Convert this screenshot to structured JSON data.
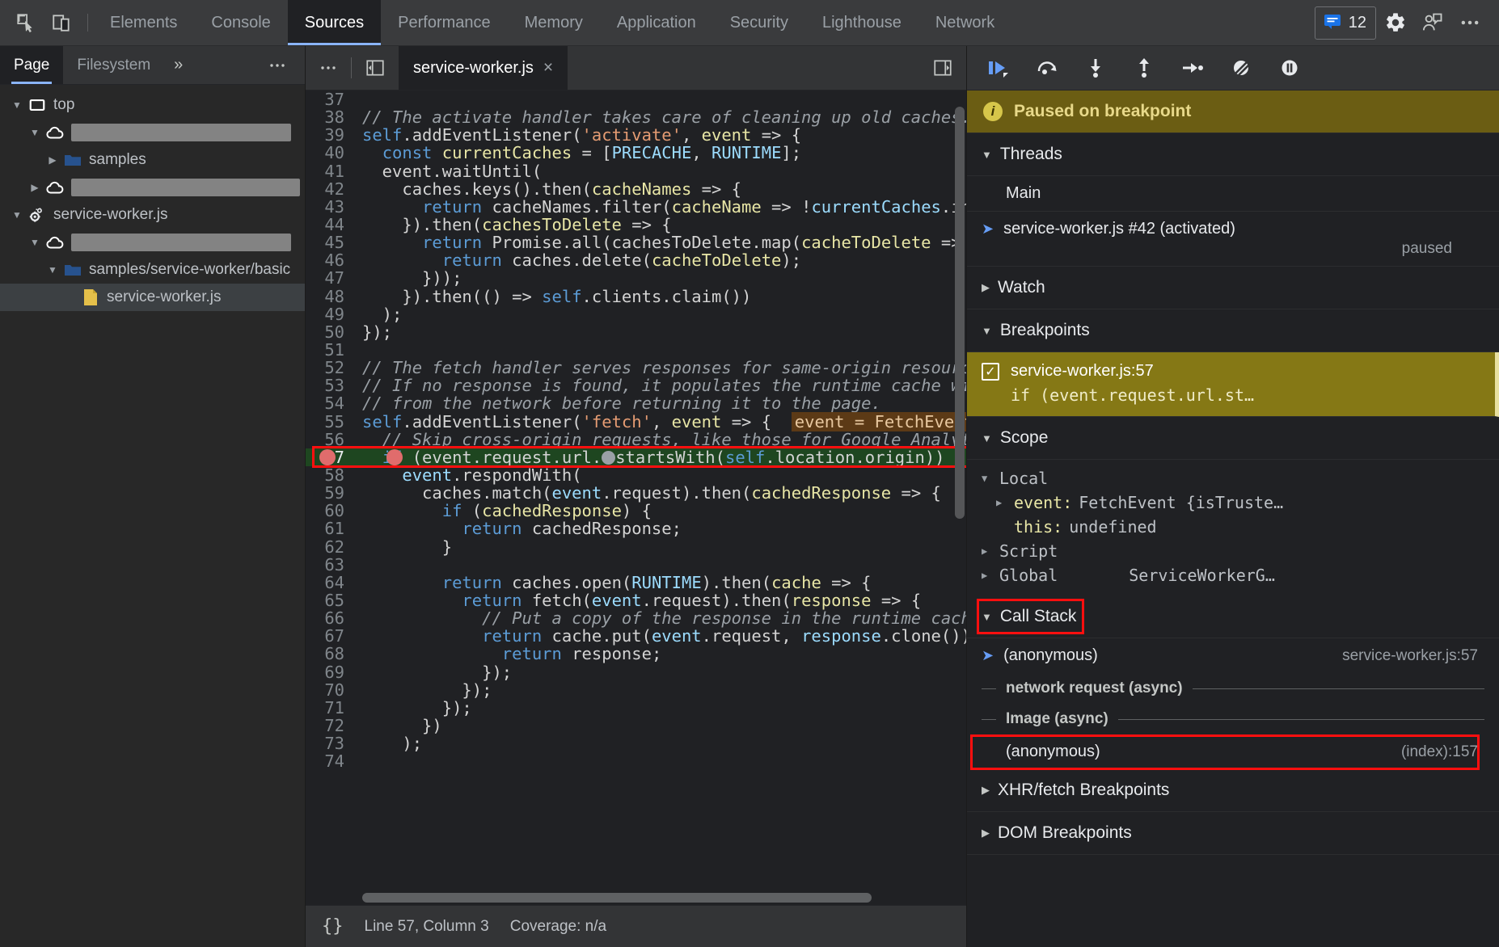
{
  "toolbar": {
    "icons": [
      {
        "name": "inspect-element-icon",
        "label": "Inspect element"
      },
      {
        "name": "device-toolbar-icon",
        "label": "Toggle device toolbar"
      }
    ],
    "tabs": [
      {
        "label": "Elements",
        "active": false
      },
      {
        "label": "Console",
        "active": false
      },
      {
        "label": "Sources",
        "active": true
      },
      {
        "label": "Performance",
        "active": false
      },
      {
        "label": "Memory",
        "active": false
      },
      {
        "label": "Application",
        "active": false
      },
      {
        "label": "Security",
        "active": false
      },
      {
        "label": "Lighthouse",
        "active": false
      },
      {
        "label": "Network",
        "active": false
      }
    ],
    "issues_count": "12",
    "settings_label": "Settings",
    "feedback_label": "Send feedback",
    "more_label": "Customize and control DevTools"
  },
  "navigator": {
    "tabs": [
      {
        "label": "Page",
        "active": true
      },
      {
        "label": "Filesystem",
        "active": false
      }
    ],
    "more_tabs": "»",
    "more_options": "⋯",
    "tree": [
      {
        "depth": 0,
        "twist": "open",
        "icon": "frame-icon",
        "label": "top",
        "redacted": false,
        "selected": false
      },
      {
        "depth": 1,
        "twist": "open",
        "icon": "cloud-icon",
        "label": "",
        "redacted": true,
        "redact_width": 272,
        "selected": false
      },
      {
        "depth": 2,
        "twist": "closed",
        "icon": "folder-icon",
        "label": "samples",
        "redacted": false,
        "selected": false
      },
      {
        "depth": 1,
        "twist": "closed",
        "icon": "cloud-icon",
        "label": "",
        "redacted": true,
        "redact_width": 298,
        "selected": false
      },
      {
        "depth": 0,
        "twist": "open",
        "icon": "worker-icon",
        "label": "service-worker.js",
        "redacted": false,
        "selected": false
      },
      {
        "depth": 1,
        "twist": "open",
        "icon": "cloud-icon",
        "label": "",
        "redacted": true,
        "redact_width": 272,
        "selected": false
      },
      {
        "depth": 2,
        "twist": "open",
        "icon": "folder-icon",
        "label": "samples/service-worker/basic",
        "redacted": false,
        "selected": false
      },
      {
        "depth": 3,
        "twist": "empty",
        "icon": "js-file-icon",
        "label": "service-worker.js",
        "redacted": false,
        "selected": true
      }
    ]
  },
  "editor": {
    "more_options": "⋯",
    "show_navigator_label": "Show navigator",
    "show_debugger_label": "Show debugger",
    "file_tab": {
      "label": "service-worker.js",
      "close": "×"
    },
    "format_button": "{}",
    "status_position": "Line 57, Column 3",
    "status_coverage": "Coverage: n/a",
    "lines": [
      {
        "num": "37",
        "tokens": [
          {
            "t": "",
            "c": ""
          }
        ]
      },
      {
        "num": "38",
        "tokens": [
          {
            "t": "// The activate handler takes care of cleaning up old caches.",
            "c": "t-com"
          }
        ]
      },
      {
        "num": "39",
        "tokens": [
          {
            "t": "self",
            "c": "t-kw"
          },
          {
            "t": ".addEventListener(",
            "c": "t-plain"
          },
          {
            "t": "'activate'",
            "c": "t-str"
          },
          {
            "t": ", ",
            "c": "t-plain"
          },
          {
            "t": "event",
            "c": "t-fn"
          },
          {
            "t": " => {",
            "c": "t-plain"
          }
        ]
      },
      {
        "num": "40",
        "tokens": [
          {
            "t": "  ",
            "c": "t-plain"
          },
          {
            "t": "const",
            "c": "t-kw"
          },
          {
            "t": " ",
            "c": "t-plain"
          },
          {
            "t": "currentCaches",
            "c": "t-fn"
          },
          {
            "t": " = [",
            "c": "t-plain"
          },
          {
            "t": "PRECACHE",
            "c": "t-prop"
          },
          {
            "t": ", ",
            "c": "t-plain"
          },
          {
            "t": "RUNTIME",
            "c": "t-prop"
          },
          {
            "t": "];",
            "c": "t-plain"
          }
        ]
      },
      {
        "num": "41",
        "tokens": [
          {
            "t": "  event.waitUntil(",
            "c": "t-plain"
          }
        ]
      },
      {
        "num": "42",
        "tokens": [
          {
            "t": "    caches.keys().then(",
            "c": "t-plain"
          },
          {
            "t": "cacheNames",
            "c": "t-fn"
          },
          {
            "t": " => {",
            "c": "t-plain"
          }
        ]
      },
      {
        "num": "43",
        "tokens": [
          {
            "t": "      ",
            "c": "t-plain"
          },
          {
            "t": "return",
            "c": "t-kw"
          },
          {
            "t": " cacheNames.filter(",
            "c": "t-plain"
          },
          {
            "t": "cacheName",
            "c": "t-fn"
          },
          {
            "t": " => !",
            "c": "t-plain"
          },
          {
            "t": "currentCaches",
            "c": "t-prop"
          },
          {
            "t": ".inclu",
            "c": "t-plain"
          }
        ]
      },
      {
        "num": "44",
        "tokens": [
          {
            "t": "    }).then(",
            "c": "t-plain"
          },
          {
            "t": "cachesToDelete",
            "c": "t-fn"
          },
          {
            "t": " => {",
            "c": "t-plain"
          }
        ]
      },
      {
        "num": "45",
        "tokens": [
          {
            "t": "      ",
            "c": "t-plain"
          },
          {
            "t": "return",
            "c": "t-kw"
          },
          {
            "t": " Promise.all(cachesToDelete.map(",
            "c": "t-plain"
          },
          {
            "t": "cacheToDelete",
            "c": "t-fn"
          },
          {
            "t": " => {",
            "c": "t-plain"
          }
        ]
      },
      {
        "num": "46",
        "tokens": [
          {
            "t": "        ",
            "c": "t-plain"
          },
          {
            "t": "return",
            "c": "t-kw"
          },
          {
            "t": " caches.delete(",
            "c": "t-plain"
          },
          {
            "t": "cacheToDelete",
            "c": "t-fn"
          },
          {
            "t": ");",
            "c": "t-plain"
          }
        ]
      },
      {
        "num": "47",
        "tokens": [
          {
            "t": "      }));",
            "c": "t-plain"
          }
        ]
      },
      {
        "num": "48",
        "tokens": [
          {
            "t": "    }).then(() => ",
            "c": "t-plain"
          },
          {
            "t": "self",
            "c": "t-kw"
          },
          {
            "t": ".clients.claim())",
            "c": "t-plain"
          }
        ]
      },
      {
        "num": "49",
        "tokens": [
          {
            "t": "  );",
            "c": "t-plain"
          }
        ]
      },
      {
        "num": "50",
        "tokens": [
          {
            "t": "});",
            "c": "t-plain"
          }
        ]
      },
      {
        "num": "51",
        "tokens": [
          {
            "t": "",
            "c": ""
          }
        ]
      },
      {
        "num": "52",
        "tokens": [
          {
            "t": "// The fetch handler serves responses for same-origin resources ",
            "c": "t-com"
          }
        ]
      },
      {
        "num": "53",
        "tokens": [
          {
            "t": "// If no response is found, it populates the runtime cache with ",
            "c": "t-com"
          }
        ]
      },
      {
        "num": "54",
        "tokens": [
          {
            "t": "// from the network before returning it to the page.",
            "c": "t-com"
          }
        ]
      },
      {
        "num": "55",
        "tokens": [
          {
            "t": "self",
            "c": "t-kw"
          },
          {
            "t": ".addEventListener(",
            "c": "t-plain"
          },
          {
            "t": "'fetch'",
            "c": "t-str"
          },
          {
            "t": ", ",
            "c": "t-plain"
          },
          {
            "t": "event",
            "c": "t-fn"
          },
          {
            "t": " => {  ",
            "c": "t-plain"
          },
          {
            "t": "event = FetchEvent {i",
            "c": "inline-val"
          }
        ]
      },
      {
        "num": "56",
        "tokens": [
          {
            "t": "  // Skip cross-origin requests, like those for Google Analytics",
            "c": "t-com"
          }
        ]
      },
      {
        "num": "57",
        "highlighted": true,
        "breakpoint": true,
        "tokens": [
          {
            "t": "  ",
            "c": "t-plain"
          },
          {
            "t": "if",
            "c": "t-kw"
          },
          {
            "t": " (event.request.url.",
            "c": "t-plain"
          },
          {
            "t": "●",
            "c": "bp-inline"
          },
          {
            "t": "startsWith(",
            "c": "t-plain"
          },
          {
            "t": "self",
            "c": "t-kw"
          },
          {
            "t": ".location.origin)) {",
            "c": "t-plain"
          }
        ]
      },
      {
        "num": "58",
        "tokens": [
          {
            "t": "    event",
            "c": "t-prop"
          },
          {
            "t": ".respondWith(",
            "c": "t-plain"
          }
        ]
      },
      {
        "num": "59",
        "tokens": [
          {
            "t": "      caches.match(",
            "c": "t-plain"
          },
          {
            "t": "event",
            "c": "t-prop"
          },
          {
            "t": ".request).then(",
            "c": "t-plain"
          },
          {
            "t": "cachedResponse",
            "c": "t-fn"
          },
          {
            "t": " => {",
            "c": "t-plain"
          }
        ]
      },
      {
        "num": "60",
        "tokens": [
          {
            "t": "        ",
            "c": "t-plain"
          },
          {
            "t": "if",
            "c": "t-kw"
          },
          {
            "t": " (",
            "c": "t-plain"
          },
          {
            "t": "cachedResponse",
            "c": "t-fn"
          },
          {
            "t": ") {",
            "c": "t-plain"
          }
        ]
      },
      {
        "num": "61",
        "tokens": [
          {
            "t": "          ",
            "c": "t-plain"
          },
          {
            "t": "return",
            "c": "t-kw"
          },
          {
            "t": " cachedResponse;",
            "c": "t-plain"
          }
        ]
      },
      {
        "num": "62",
        "tokens": [
          {
            "t": "        }",
            "c": "t-plain"
          }
        ]
      },
      {
        "num": "63",
        "tokens": [
          {
            "t": "",
            "c": ""
          }
        ]
      },
      {
        "num": "64",
        "tokens": [
          {
            "t": "        ",
            "c": "t-plain"
          },
          {
            "t": "return",
            "c": "t-kw"
          },
          {
            "t": " caches.open(",
            "c": "t-plain"
          },
          {
            "t": "RUNTIME",
            "c": "t-prop"
          },
          {
            "t": ").then(",
            "c": "t-plain"
          },
          {
            "t": "cache",
            "c": "t-fn"
          },
          {
            "t": " => {",
            "c": "t-plain"
          }
        ]
      },
      {
        "num": "65",
        "tokens": [
          {
            "t": "          ",
            "c": "t-plain"
          },
          {
            "t": "return",
            "c": "t-kw"
          },
          {
            "t": " fetch(",
            "c": "t-plain"
          },
          {
            "t": "event",
            "c": "t-prop"
          },
          {
            "t": ".request).then(",
            "c": "t-plain"
          },
          {
            "t": "response",
            "c": "t-fn"
          },
          {
            "t": " => {",
            "c": "t-plain"
          }
        ]
      },
      {
        "num": "66",
        "tokens": [
          {
            "t": "            // Put a copy of the response in the runtime cache.",
            "c": "t-com"
          }
        ]
      },
      {
        "num": "67",
        "tokens": [
          {
            "t": "            ",
            "c": "t-plain"
          },
          {
            "t": "return",
            "c": "t-kw"
          },
          {
            "t": " cache.put(",
            "c": "t-plain"
          },
          {
            "t": "event",
            "c": "t-prop"
          },
          {
            "t": ".request, ",
            "c": "t-plain"
          },
          {
            "t": "response",
            "c": "t-prop"
          },
          {
            "t": ".clone()).th",
            "c": "t-plain"
          }
        ]
      },
      {
        "num": "68",
        "tokens": [
          {
            "t": "              ",
            "c": "t-plain"
          },
          {
            "t": "return",
            "c": "t-kw"
          },
          {
            "t": " response;",
            "c": "t-plain"
          }
        ]
      },
      {
        "num": "69",
        "tokens": [
          {
            "t": "            });",
            "c": "t-plain"
          }
        ]
      },
      {
        "num": "70",
        "tokens": [
          {
            "t": "          });",
            "c": "t-plain"
          }
        ]
      },
      {
        "num": "71",
        "tokens": [
          {
            "t": "        });",
            "c": "t-plain"
          }
        ]
      },
      {
        "num": "72",
        "tokens": [
          {
            "t": "      })",
            "c": "t-plain"
          }
        ]
      },
      {
        "num": "73",
        "tokens": [
          {
            "t": "    );",
            "c": "t-plain"
          }
        ]
      },
      {
        "num": "74",
        "tokens": [
          {
            "t": "",
            "c": ""
          }
        ]
      }
    ]
  },
  "debugger": {
    "toolbar_buttons": [
      {
        "name": "resume-script-execution-icon",
        "label": "Resume script execution"
      },
      {
        "name": "step-over-icon",
        "label": "Step over next function call"
      },
      {
        "name": "step-into-icon",
        "label": "Step into next function call"
      },
      {
        "name": "step-out-icon",
        "label": "Step out of current function"
      },
      {
        "name": "step-icon",
        "label": "Step"
      },
      {
        "name": "deactivate-breakpoints-icon",
        "label": "Deactivate breakpoints"
      },
      {
        "name": "pause-on-exceptions-icon",
        "label": "Pause on exceptions"
      }
    ],
    "paused_banner": "Paused on breakpoint",
    "threads": {
      "title": "Threads",
      "items": [
        {
          "label": "Main",
          "selected": false,
          "state": ""
        },
        {
          "label": "service-worker.js #42 (activated)",
          "selected": true,
          "state": "paused"
        }
      ]
    },
    "watch": {
      "title": "Watch",
      "expanded": false
    },
    "breakpoints": {
      "title": "Breakpoints",
      "items": [
        {
          "checked": true,
          "location": "service-worker.js:57",
          "snippet": "if (event.request.url.st…"
        }
      ]
    },
    "scope": {
      "title": "Scope",
      "groups": [
        {
          "name": "Local",
          "expanded": true,
          "tri": "open",
          "value": "",
          "entries": [
            {
              "tri": "closed",
              "name": "event:",
              "value": "FetchEvent {isTruste…"
            },
            {
              "tri": "none",
              "name": "this:",
              "value": "undefined"
            }
          ]
        },
        {
          "name": "Script",
          "expanded": false,
          "tri": "closed",
          "value": "",
          "entries": []
        },
        {
          "name": "Global",
          "expanded": false,
          "tri": "closed",
          "value": "ServiceWorkerG…",
          "entries": []
        }
      ]
    },
    "call_stack": {
      "title": "Call Stack",
      "frames": [
        {
          "type": "frame",
          "label": "(anonymous)",
          "location": "service-worker.js:57",
          "current": true,
          "boxed": false
        },
        {
          "type": "async",
          "label": "network request (async)"
        },
        {
          "type": "async",
          "label": "Image (async)"
        },
        {
          "type": "frame",
          "label": "(anonymous)",
          "location": "(index):157",
          "current": false,
          "boxed": true
        }
      ]
    },
    "xhr_breakpoints": {
      "title": "XHR/fetch Breakpoints",
      "expanded": false
    },
    "dom_breakpoints": {
      "title": "DOM Breakpoints",
      "expanded": false
    }
  }
}
